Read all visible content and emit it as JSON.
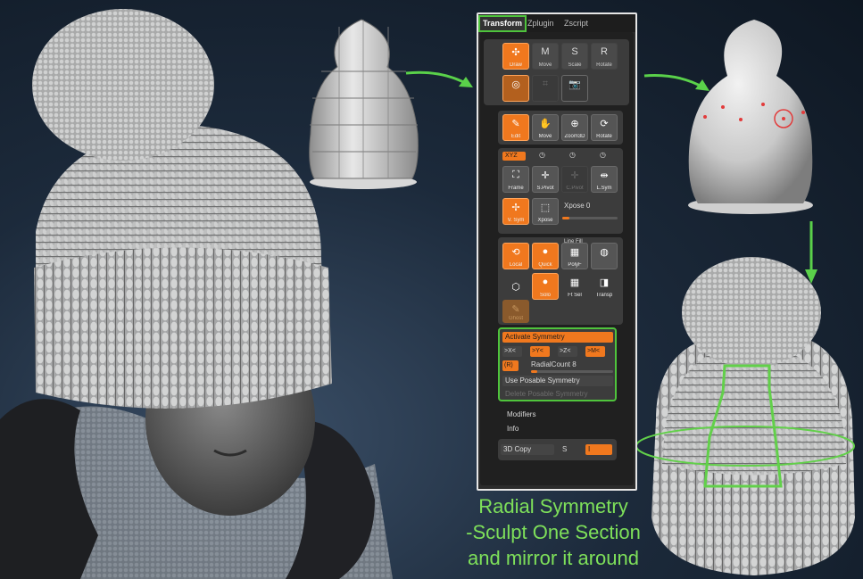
{
  "tabs": [
    "Transform",
    "Zplugin",
    "Zscript"
  ],
  "transform_tools": [
    {
      "label": "Draw",
      "icon": "draw-icon",
      "on": true
    },
    {
      "label": "Move",
      "icon": "move-icon",
      "on": false
    },
    {
      "label": "Scale",
      "icon": "scale-icon",
      "on": false
    },
    {
      "label": "Rotate",
      "icon": "rotate-icon",
      "on": false
    }
  ],
  "view_tools": [
    {
      "label": "Edit",
      "on": true
    },
    {
      "label": "Move",
      "on": false
    },
    {
      "label": "Zoom3D",
      "on": false
    },
    {
      "label": "Rotate",
      "on": false
    }
  ],
  "axis_row": {
    "active": "XYZ"
  },
  "frame_tools": [
    {
      "label": "Frame",
      "on": false,
      "dim": false
    },
    {
      "label": "S.Pivot",
      "on": false,
      "dim": false
    },
    {
      "label": "C.Pivot",
      "on": false,
      "dim": true
    },
    {
      "label": "L.Sym",
      "on": false,
      "dim": false
    }
  ],
  "xpose_row": {
    "vsym_label": "V. Sym",
    "xpose_btn_label": "Xpose",
    "xpose_text": "Xpose 0"
  },
  "display_tools": {
    "line_fill": "Line Fill",
    "local": "Local",
    "quick": "Quick",
    "polyf": "PolyF",
    "solo": "Solo",
    "ftsel": "Ft Sel",
    "transp": "Transp",
    "ghost": "Ghost"
  },
  "symmetry": {
    "activate": "Activate Symmetry",
    "axes": [
      ">X<",
      ">Y<",
      ">Z<",
      ">M<"
    ],
    "axes_on": [
      false,
      true,
      false,
      true
    ],
    "r_label": "(R)",
    "radial_count": "RadialCount 8",
    "radial_count_value": 0.08,
    "use_posable": "Use Posable Symmetry",
    "delete_posable": "Delete Posable Symmetry"
  },
  "modifiers": "Modifiers",
  "info": "Info",
  "copy_row": {
    "copy": "3D Copy",
    "s": "S",
    "i": "I"
  },
  "caption": [
    "Radial Symmetry",
    "-Sculpt One Section",
    "and mirror it around"
  ],
  "colors": {
    "accent": "#f0781e",
    "highlight_green": "#4fc43c",
    "caption_green": "#7ee05a"
  }
}
